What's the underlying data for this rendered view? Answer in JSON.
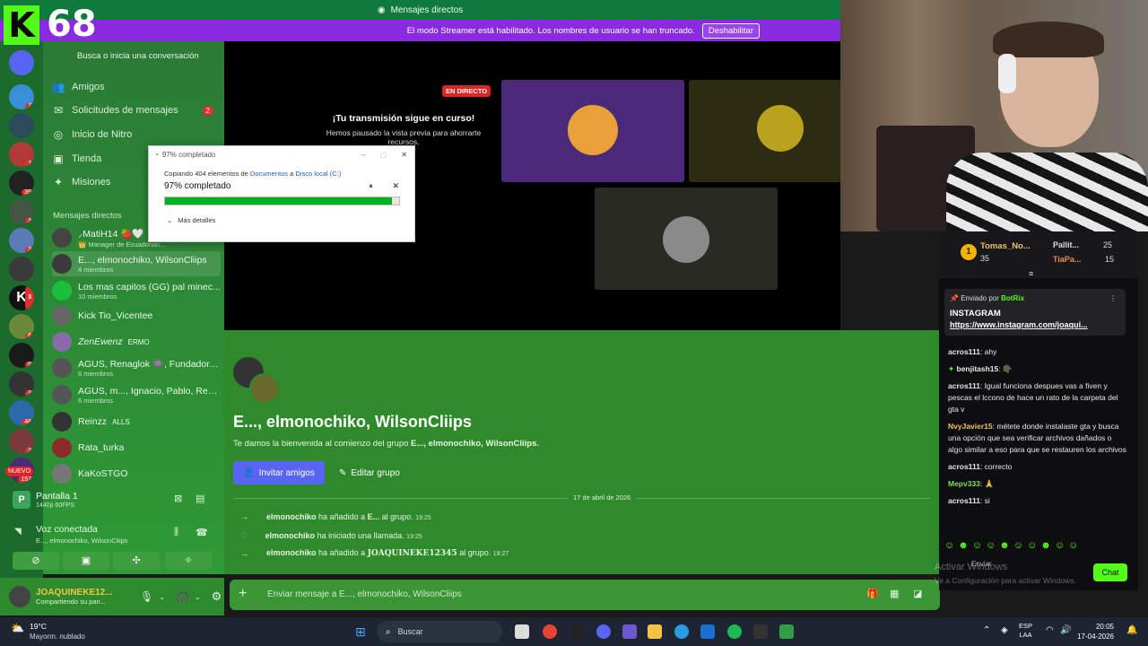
{
  "title_bar": {
    "title": "Mensajes directos"
  },
  "streamer_banner": {
    "text": "El modo Streamer está habilitado. Los nombres de usuario se han truncado.",
    "button": "Deshabilitar"
  },
  "overlay_counter": {
    "letter": "K",
    "value": "68"
  },
  "sidebar": {
    "search_placeholder": "Busca o inicia una conversación",
    "nav": [
      {
        "label": "Amigos",
        "icon": "friends-icon"
      },
      {
        "label": "Solicitudes de mensajes",
        "badge": "2",
        "icon": "mail-icon"
      },
      {
        "label": "Inicio de Nitro",
        "icon": "nitro-icon"
      },
      {
        "label": "Tienda",
        "icon": "shop-icon"
      },
      {
        "label": "Misiones",
        "icon": "quest-icon"
      }
    ],
    "dm_header": "Mensajes directos",
    "dms": [
      {
        "name": "⸝MatiH14 🍓🤍",
        "sub": "👑 Manager de Ecuadorian..."
      },
      {
        "name": "E..., elmonochiko, WilsonCliips",
        "sub": "4 miembros"
      },
      {
        "name": "Los mas capitos (GG) pal minec...",
        "sub": "10 miembros"
      },
      {
        "name": "Kick Tio_Vicentee",
        "sub": ""
      },
      {
        "name": "ZenEwenz",
        "sub": "",
        "tag": "ERMO"
      },
      {
        "name": "AGUS, Renaglok 👾, Fundador, ...",
        "sub": "6 miembros"
      },
      {
        "name": "AGUS, m..., Ignacio, Pablo, Ren...",
        "sub": "6 miembros"
      },
      {
        "name": "Reinzz",
        "sub": "",
        "tag": "ALLS"
      },
      {
        "name": "Rata_turka",
        "sub": ""
      },
      {
        "name": "KaKoSTGO",
        "sub": ""
      }
    ]
  },
  "server_badges": [
    "",
    "7",
    "",
    "7",
    "",
    "39",
    "3",
    "3",
    "",
    "3",
    "6",
    "8",
    "",
    "3",
    "46",
    "3",
    "157",
    "NUEVO"
  ],
  "voice": {
    "share_title": "Pantalla 1",
    "share_sub": "1440p 60FPS",
    "status": "Voz conectada",
    "channel": "E..., elmonochiko, WilsonCliips"
  },
  "user": {
    "name": "JOAQUINEKE12...",
    "status": "Compartiendo su pan..."
  },
  "stream": {
    "live_badge": "EN DIRECTO",
    "heading": "¡Tu transmisión sigue en curso!",
    "sub": "Hemos pausado la vista previa para ahorrarte recursos."
  },
  "copy_dialog": {
    "title": "97% completado",
    "line": "Copiando 404 elementos de",
    "src": "Documentos",
    "mid": "a",
    "dest": "Disco local (C:)",
    "percent_text": "97% completado",
    "progress": 0.97,
    "details": "Más detalles"
  },
  "group": {
    "title": "E..., elmonochiko, WilsonCliips",
    "welcome_prefix": "Te damos la bienvenida al comienzo del grupo",
    "welcome_group": "E..., elmonochiko, WilsonCliips.",
    "invite_button": "Invitar amigos",
    "edit_button": "Editar grupo",
    "date_divider": "17 de abril de 2026",
    "events": [
      {
        "actor": "elmonochiko",
        "action": "ha añadido a",
        "target": "E...",
        "suffix": "al grupo.",
        "time": "19:25",
        "icon": "arrow-right-icon"
      },
      {
        "actor": "elmonochiko",
        "action": "ha iniciado una llamada.",
        "target": "",
        "suffix": "",
        "time": "19:25",
        "icon": "phone-icon"
      },
      {
        "actor": "elmonochiko",
        "action": "ha añadido a",
        "target": "JOAQUINEKE12345",
        "suffix": "al grupo.",
        "time": "19:27",
        "icon": "arrow-right-icon"
      }
    ],
    "composer_placeholder": "Enviar mensaje a E..., elmonochiko, WilsonCliips"
  },
  "leaderboard": {
    "first": {
      "name": "Tomas_No...",
      "score": "35"
    },
    "second": {
      "name": "Pallit...",
      "score": "25"
    },
    "third": {
      "name": "TiaPa...",
      "score": "15"
    }
  },
  "pinned": {
    "sent_by": "Enviado por",
    "bot": "BotRix",
    "title": "INSTAGRAM",
    "link": "https://www.instagram.com/joaqui..."
  },
  "chat": [
    {
      "user": "acros111",
      "color": "#e9e9e9",
      "text": "ahy"
    },
    {
      "user": "benjitash15",
      "color": "#e9e9e9",
      "text": ""
    },
    {
      "user": "acros111",
      "color": "#e9e9e9",
      "text": "Igual funciona despues vas a fiven y pescas el lccono de hace un rato de la carpeta del gta v"
    },
    {
      "user": "NvyJavier15",
      "color": "#f0c06a",
      "text": "métete donde instalaste gta y busca una opción que sea verificar archivos dañados o algo similar a eso para que se restauren los archivos"
    },
    {
      "user": "acros111",
      "color": "#e9e9e9",
      "text": "correcto"
    },
    {
      "user": "Mepv333",
      "color": "#7ddc5a",
      "text": ""
    },
    {
      "user": "acros111",
      "color": "#e9e9e9",
      "text": "si"
    }
  ],
  "chat_input": {
    "placeholder": "Enviar",
    "button": "Chat"
  },
  "watermark": {
    "line1": "Activar Windows",
    "line2": "Ve a Configuración para activar Windows."
  },
  "taskbar": {
    "weather_temp": "19°C",
    "weather_desc": "Mayorm. nublado",
    "search": "Buscar",
    "lang1": "ESP",
    "lang2": "LAA",
    "time": "20:05",
    "date": "17-04-2026"
  }
}
